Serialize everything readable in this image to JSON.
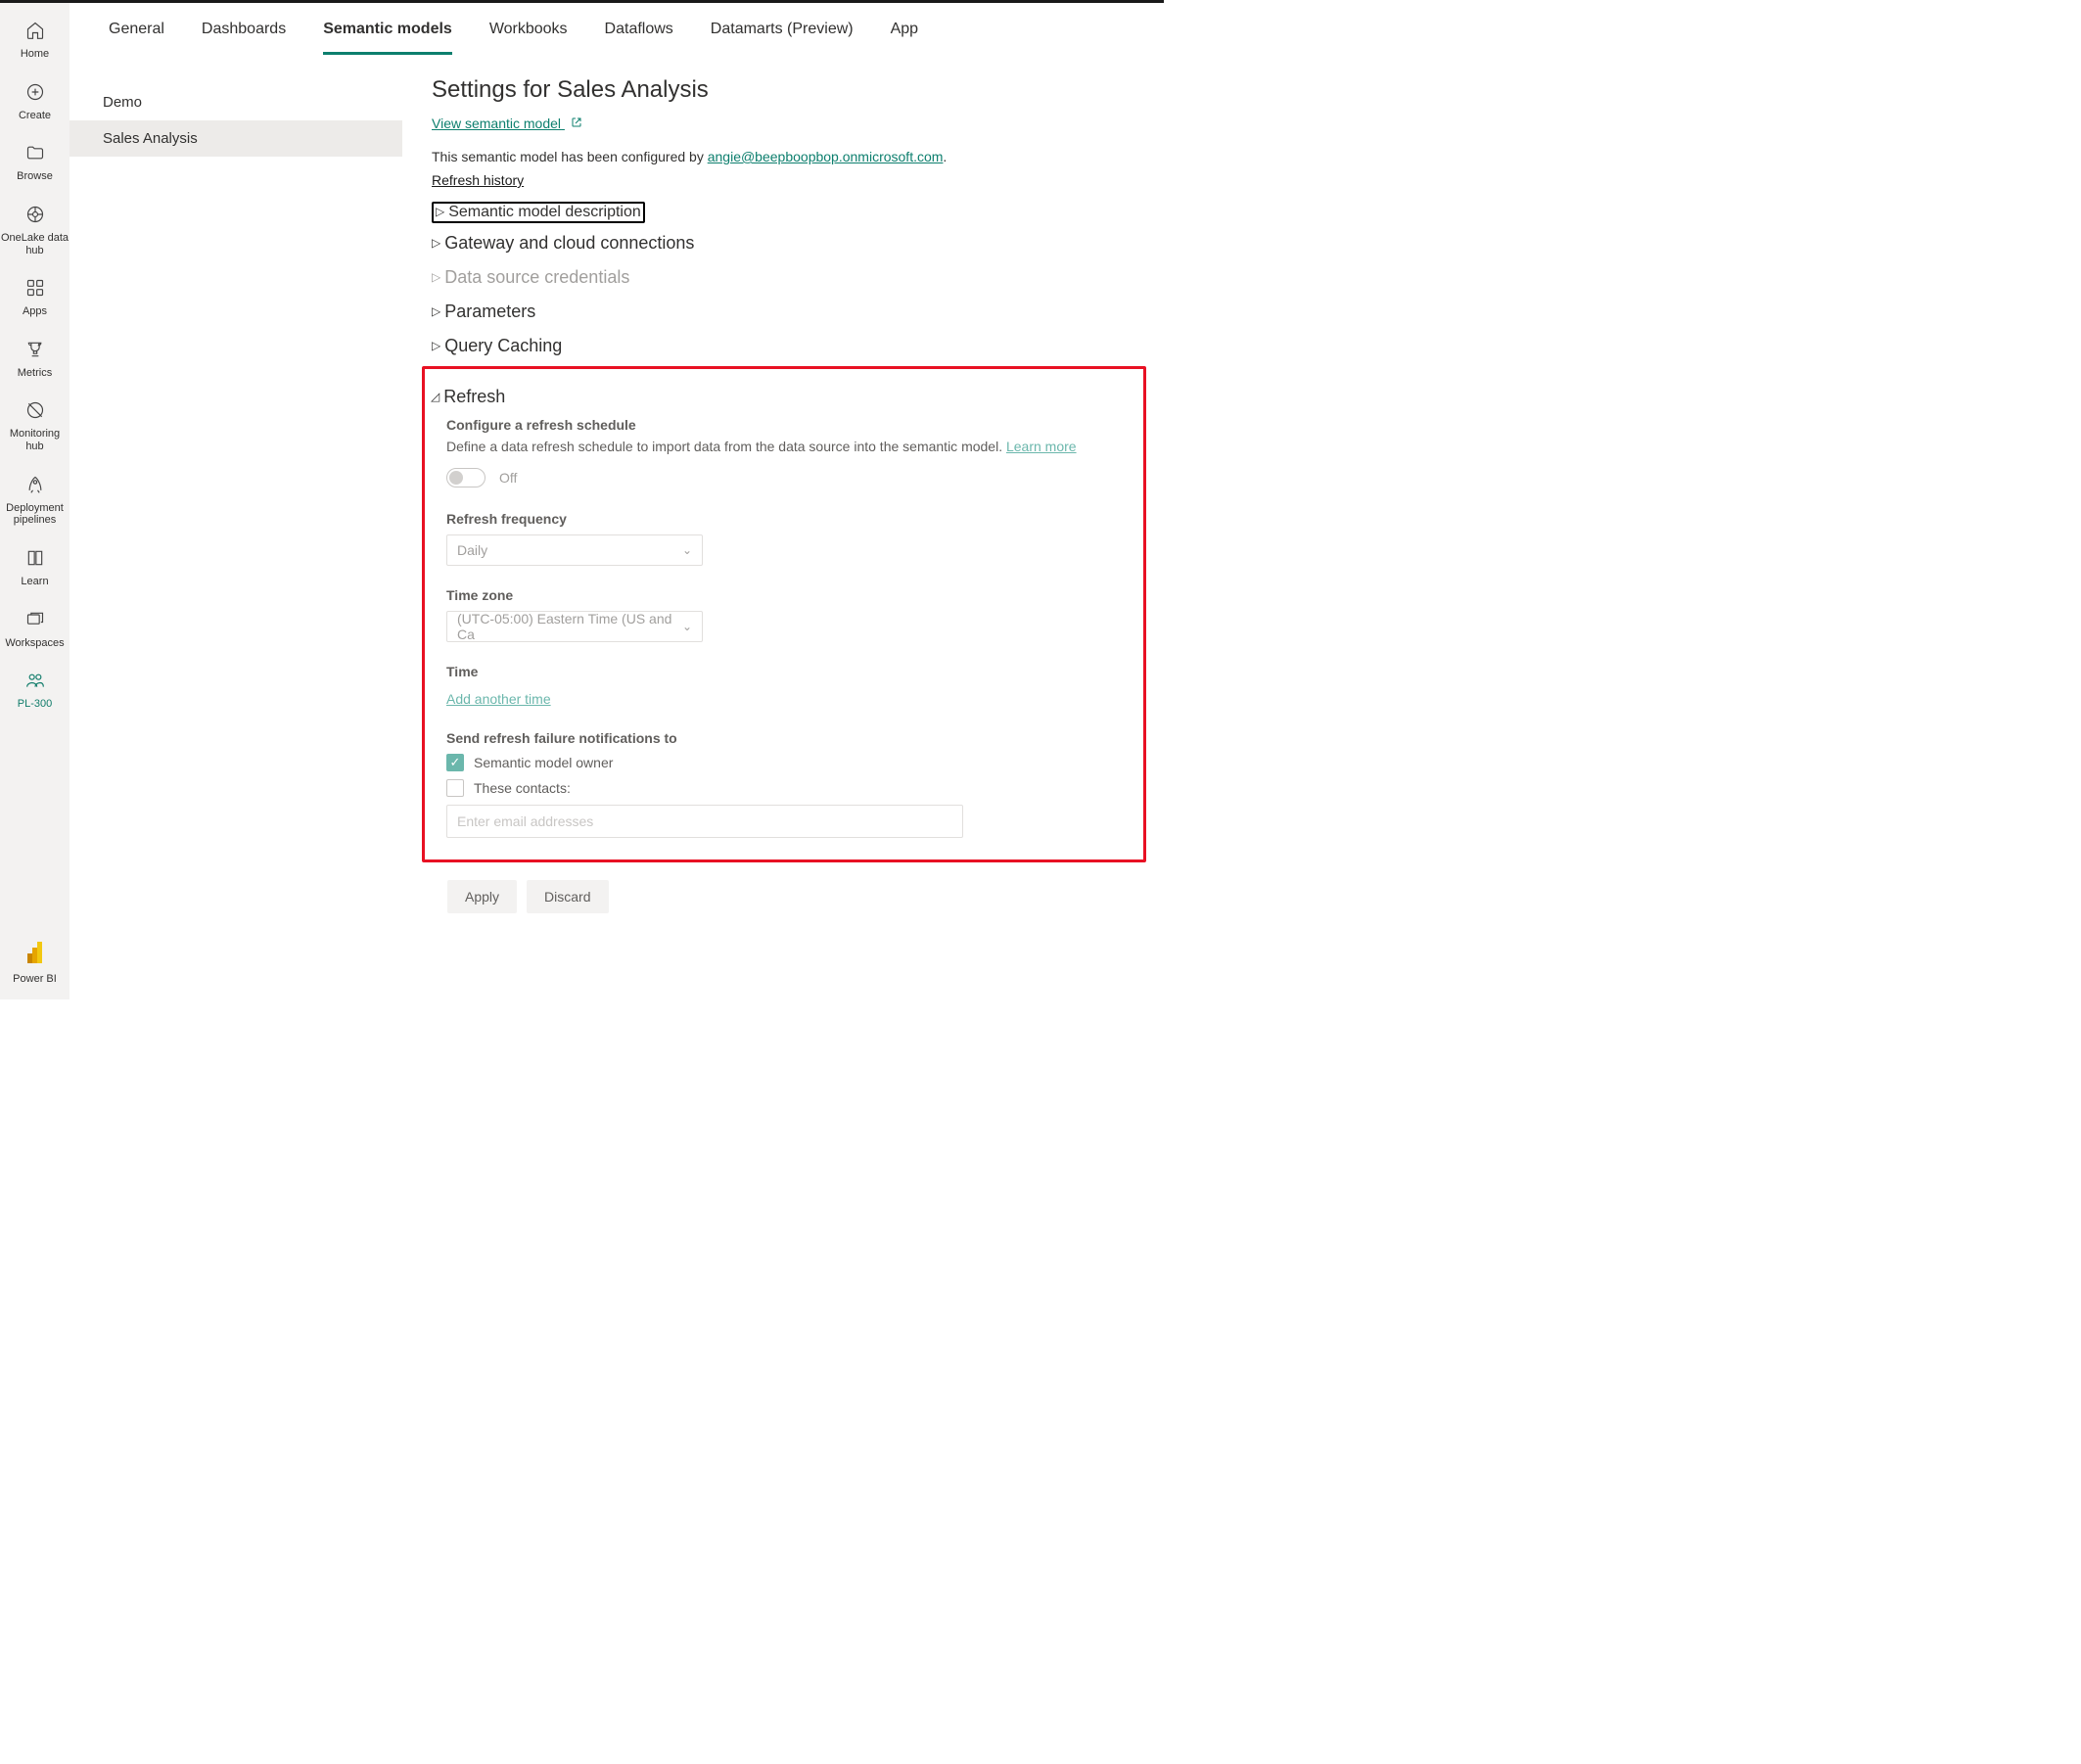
{
  "leftnav": {
    "items": [
      {
        "label": "Home"
      },
      {
        "label": "Create"
      },
      {
        "label": "Browse"
      },
      {
        "label": "OneLake data hub"
      },
      {
        "label": "Apps"
      },
      {
        "label": "Metrics"
      },
      {
        "label": "Monitoring hub"
      },
      {
        "label": "Deployment pipelines"
      },
      {
        "label": "Learn"
      },
      {
        "label": "Workspaces"
      },
      {
        "label": "PL-300"
      }
    ],
    "footer": "Power BI"
  },
  "tabs": [
    {
      "label": "General"
    },
    {
      "label": "Dashboards"
    },
    {
      "label": "Semantic models"
    },
    {
      "label": "Workbooks"
    },
    {
      "label": "Dataflows"
    },
    {
      "label": "Datamarts (Preview)"
    },
    {
      "label": "App"
    }
  ],
  "sidelist": [
    {
      "label": "Demo"
    },
    {
      "label": "Sales Analysis"
    }
  ],
  "page": {
    "title": "Settings for Sales Analysis",
    "view_link": "View semantic model",
    "configured_prefix": "This semantic model has been configured by ",
    "configured_email": "angie@beepboopbop.onmicrosoft.com",
    "configured_suffix": ".",
    "refresh_history": "Refresh history"
  },
  "expanders": {
    "desc": "Semantic model description",
    "gateway": "Gateway and cloud connections",
    "creds": "Data source credentials",
    "params": "Parameters",
    "cache": "Query Caching",
    "refresh": "Refresh"
  },
  "refresh": {
    "subtitle": "Configure a refresh schedule",
    "desc": "Define a data refresh schedule to import data from the data source into the semantic model.  ",
    "learn_more": "Learn more",
    "toggle_state": "Off",
    "freq_label": "Refresh frequency",
    "freq_value": "Daily",
    "tz_label": "Time zone",
    "tz_value": "(UTC-05:00) Eastern Time (US and Ca",
    "time_label": "Time",
    "add_time": "Add another time",
    "notify_label": "Send refresh failure notifications to",
    "chk_owner": "Semantic model owner",
    "chk_contacts": "These contacts:",
    "email_placeholder": "Enter email addresses"
  },
  "buttons": {
    "apply": "Apply",
    "discard": "Discard"
  }
}
